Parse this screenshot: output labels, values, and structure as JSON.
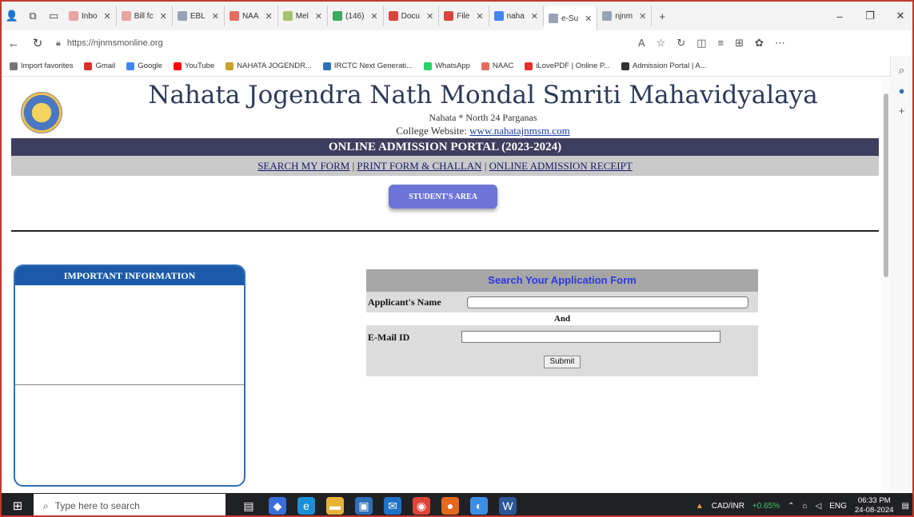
{
  "browser": {
    "tabs": [
      {
        "label": "Inbo",
        "color": "#e9a4a4"
      },
      {
        "label": "Bill fc",
        "color": "#e9a4a4"
      },
      {
        "label": "EBL",
        "color": "#9aa3b5"
      },
      {
        "label": "NAA",
        "color": "#e56b5b"
      },
      {
        "label": "Mel",
        "color": "#a6c26b"
      },
      {
        "label": "(146)",
        "color": "#3caa5a"
      },
      {
        "label": "Docu",
        "color": "#d9443c"
      },
      {
        "label": "File",
        "color": "#d9443c"
      },
      {
        "label": "naha",
        "color": "#4285f4"
      },
      {
        "label": "e-Su",
        "color": "#9aa3b5"
      },
      {
        "label": "njnm",
        "color": "#9aa3b5"
      }
    ],
    "url": "https://njnmsmonline.org",
    "favorites": [
      {
        "label": "Import favorites",
        "color": "#777777"
      },
      {
        "label": "Gmail",
        "color": "#d93025"
      },
      {
        "label": "Google",
        "color": "#4285f4"
      },
      {
        "label": "YouTube",
        "color": "#ff0000"
      },
      {
        "label": "NAHATA JOGENDR...",
        "color": "#c9a227"
      },
      {
        "label": "IRCTC Next Generati...",
        "color": "#2f6fb7"
      },
      {
        "label": "WhatsApp",
        "color": "#25d366"
      },
      {
        "label": "NAAC",
        "color": "#e56b5b"
      },
      {
        "label": "iLovePDF | Online P...",
        "color": "#e5322d"
      },
      {
        "label": "Admission Portal | A...",
        "color": "#333333"
      }
    ]
  },
  "page": {
    "college_name": "Nahata Jogendra Nath Mondal Smriti Mahavidyalaya",
    "location": "Nahata * North 24 Parganas",
    "website_prefix": "College Website: ",
    "website_link": "www.nahatajnmsm.com",
    "portal_title": "ONLINE ADMISSION PORTAL (2023-2024)",
    "menu": {
      "search_form": "SEARCH MY FORM",
      "print_form": "PRINT FORM & CHALLAN",
      "receipt": "ONLINE ADMISSION RECEIPT",
      "separator": " | "
    },
    "student_area": "STUDENT'S AREA",
    "info_title": "IMPORTANT INFORMATION",
    "search": {
      "title": "Search Your Application Form",
      "name_label": "Applicant's Name",
      "and": "And",
      "email_label": "E-Mail ID",
      "submit": "Submit"
    }
  },
  "taskbar": {
    "search_placeholder": "Type here to search",
    "ticker_label": "CAD/INR",
    "ticker_change": "+0.65%",
    "lang": "ENG",
    "time": "06:33 PM",
    "date": "24-08-2024"
  }
}
